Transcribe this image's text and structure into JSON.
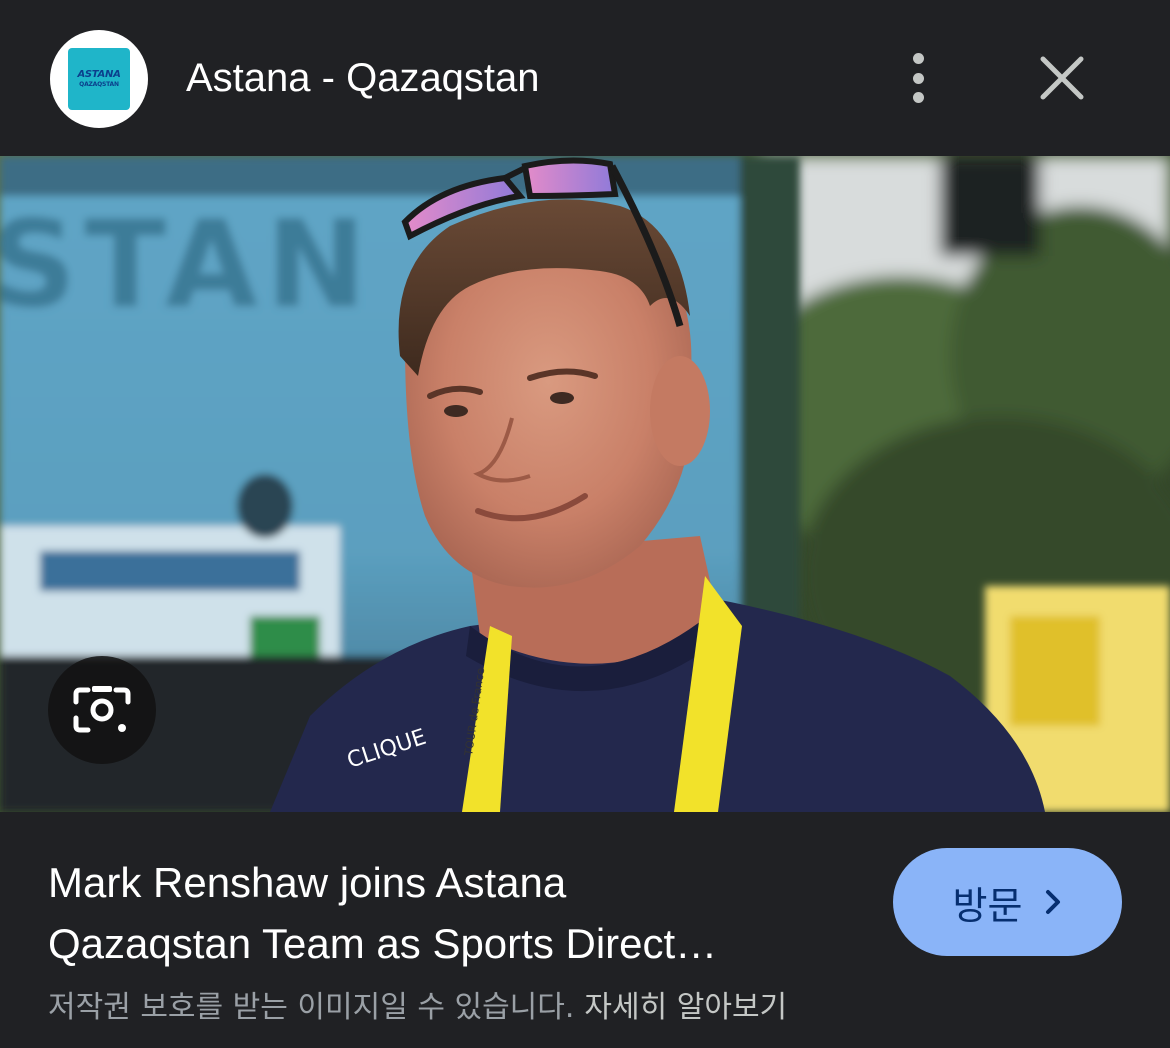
{
  "header": {
    "site_name": "Astana - Qazaqstan",
    "logo_text_line1": "ASTANA",
    "logo_text_line2": "QAZAQSTAN",
    "more_icon": "more-vert-icon",
    "close_icon": "close-icon"
  },
  "image": {
    "shirt_text": "CLIQUE",
    "lanyard_text": "TOUR de France",
    "bus_text": "STAN",
    "lens_icon": "google-lens-icon"
  },
  "result": {
    "headline_line1": "Mark Renshaw joins Astana",
    "headline_line2": "Qazaqstan Team as Sports Direct…",
    "visit_label": "방문",
    "visit_icon": "chevron-right-icon",
    "copyright_notice": "저작권 보호를 받는 이미지일 수 있습니다.",
    "learn_more": "자세히 알아보기"
  },
  "colors": {
    "background": "#202124",
    "visit_button": "#8ab4f8",
    "logo_teal": "#1fb5c9"
  }
}
